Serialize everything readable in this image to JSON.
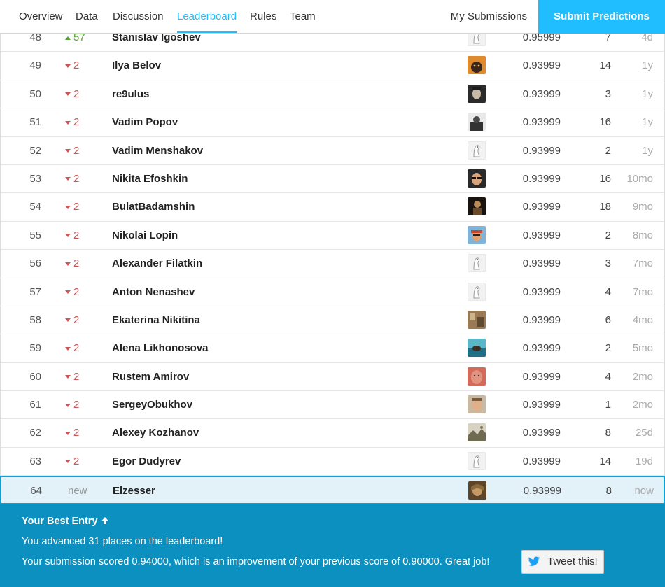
{
  "nav": {
    "tabs": [
      "Overview",
      "Data",
      "Discussion",
      "Leaderboard",
      "Rules",
      "Team"
    ],
    "active_tab": "Leaderboard",
    "my_submissions": "My Submissions",
    "submit_label": "Submit Predictions"
  },
  "rows": [
    {
      "rank": "48",
      "move_dir": "up",
      "move": "57",
      "name": "Stanislav Igoshev",
      "avatar": "default",
      "score": "0.95999",
      "entries": "7",
      "last": "4d",
      "dots": 1
    },
    {
      "rank": "49",
      "move_dir": "down",
      "move": "2",
      "name": "Ilya Belov",
      "avatar": "cat",
      "score": "0.93999",
      "entries": "14",
      "last": "1y",
      "dots": 1
    },
    {
      "rank": "50",
      "move_dir": "down",
      "move": "2",
      "name": "re9ulus",
      "avatar": "face-dark",
      "score": "0.93999",
      "entries": "3",
      "last": "1y",
      "dots": 2
    },
    {
      "rank": "51",
      "move_dir": "down",
      "move": "2",
      "name": "Vadim Popov",
      "avatar": "person-dark",
      "score": "0.93999",
      "entries": "16",
      "last": "1y",
      "dots": 2
    },
    {
      "rank": "52",
      "move_dir": "down",
      "move": "2",
      "name": "Vadim Menshakov",
      "avatar": "default",
      "score": "0.93999",
      "entries": "2",
      "last": "1y",
      "dots": 1
    },
    {
      "rank": "53",
      "move_dir": "down",
      "move": "2",
      "name": "Nikita Efoshkin",
      "avatar": "face-glasses",
      "score": "0.93999",
      "entries": "16",
      "last": "10mo",
      "dots": 2
    },
    {
      "rank": "54",
      "move_dir": "down",
      "move": "2",
      "name": "BulatBadamshin",
      "avatar": "person-night",
      "score": "0.93999",
      "entries": "18",
      "last": "9mo",
      "dots": 1
    },
    {
      "rank": "55",
      "move_dir": "down",
      "move": "2",
      "name": "Nikolai Lopin",
      "avatar": "person-hat",
      "score": "0.93999",
      "entries": "2",
      "last": "8mo",
      "dots": 1
    },
    {
      "rank": "56",
      "move_dir": "down",
      "move": "2",
      "name": "Alexander Filatkin",
      "avatar": "default",
      "score": "0.93999",
      "entries": "3",
      "last": "7mo",
      "dots": 1
    },
    {
      "rank": "57",
      "move_dir": "down",
      "move": "2",
      "name": "Anton Nenashev",
      "avatar": "default",
      "score": "0.93999",
      "entries": "4",
      "last": "7mo",
      "dots": 1
    },
    {
      "rank": "58",
      "move_dir": "down",
      "move": "2",
      "name": "Ekaterina Nikitina",
      "avatar": "room",
      "score": "0.93999",
      "entries": "6",
      "last": "4mo",
      "dots": 1
    },
    {
      "rank": "59",
      "move_dir": "down",
      "move": "2",
      "name": "Alena Likhonosova",
      "avatar": "sea",
      "score": "0.93999",
      "entries": "2",
      "last": "5mo",
      "dots": 1
    },
    {
      "rank": "60",
      "move_dir": "down",
      "move": "2",
      "name": "Rustem Amirov",
      "avatar": "face-red",
      "score": "0.93999",
      "entries": "4",
      "last": "2mo",
      "dots": 1
    },
    {
      "rank": "61",
      "move_dir": "down",
      "move": "2",
      "name": "SergeyObukhov",
      "avatar": "face-light",
      "score": "0.93999",
      "entries": "1",
      "last": "2mo",
      "dots": 1
    },
    {
      "rank": "62",
      "move_dir": "down",
      "move": "2",
      "name": "Alexey Kozhanov",
      "avatar": "outdoor",
      "score": "0.93999",
      "entries": "8",
      "last": "25d",
      "dots": 1
    },
    {
      "rank": "63",
      "move_dir": "down",
      "move": "2",
      "name": "Egor Dudyrev",
      "avatar": "default",
      "score": "0.93999",
      "entries": "14",
      "last": "19d",
      "dots": 1
    },
    {
      "rank": "64",
      "move_dir": "new",
      "move": "new",
      "name": "Elzesser",
      "avatar": "person-brown",
      "score": "0.93999",
      "entries": "8",
      "last": "now",
      "dots": 1,
      "highlight": true
    }
  ],
  "best_entry": {
    "title": "Your Best Entry",
    "advanced": "You advanced 31 places on the leaderboard!",
    "scored": "Your submission scored 0.94000, which is an improvement of your previous score of 0.90000. Great job!",
    "tweet_label": "Tweet this!"
  },
  "colors": {
    "accent": "#20beff",
    "panel": "#0b90c0",
    "down": "#cc5555",
    "up": "#5a9e3a",
    "highlight_bg": "#e3f1f9"
  }
}
